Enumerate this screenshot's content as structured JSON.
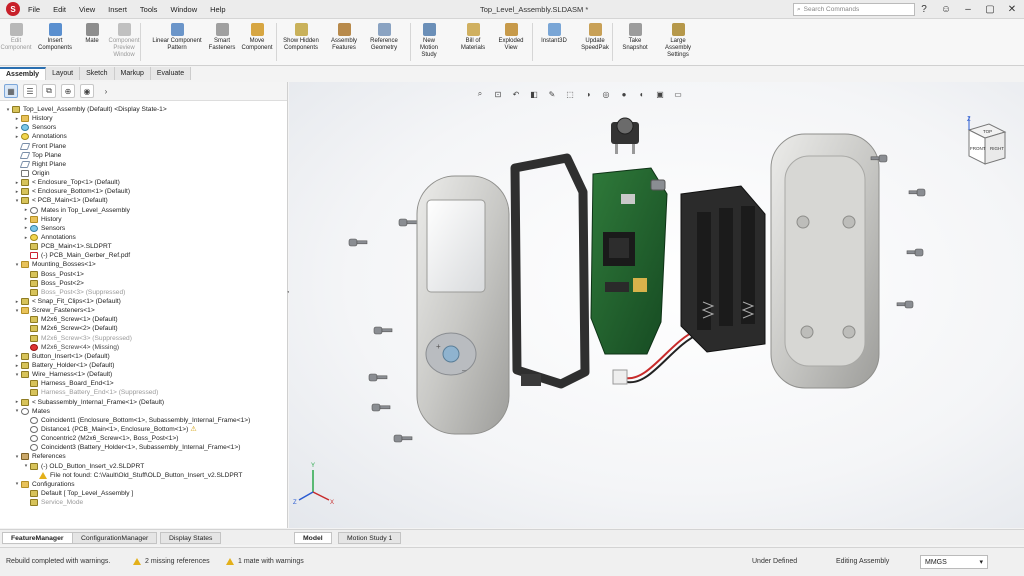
{
  "app": {
    "logo_text": "S",
    "menu": [
      "File",
      "Edit",
      "View",
      "Insert",
      "Tools",
      "Window",
      "Help"
    ],
    "doc_title": "Top_Level_Assembly.SLDASM *",
    "search_placeholder": "Search Commands",
    "title_icons": [
      "help-icon",
      "user-icon",
      "minimize-icon",
      "restore-icon",
      "close-icon"
    ]
  },
  "ribbon": {
    "buttons": [
      {
        "label": "Edit Component",
        "disabled": true,
        "icon": "edit-component-icon",
        "color": "#b8b8b8"
      },
      {
        "label": "Insert Components",
        "disabled": false,
        "icon": "insert-components-icon",
        "color": "#5a8fcf"
      },
      {
        "label": "Mate",
        "disabled": false,
        "icon": "mate-icon",
        "color": "#8d8d8d"
      },
      {
        "label": "Component Preview Window",
        "disabled": true,
        "icon": "preview-window-icon",
        "color": "#c0c0c0"
      },
      {
        "label": "Linear Component Pattern",
        "disabled": false,
        "icon": "linear-pattern-icon",
        "color": "#6b95c9"
      },
      {
        "label": "Smart Fasteners",
        "disabled": false,
        "icon": "smart-fasteners-icon",
        "color": "#a0a0a0"
      },
      {
        "label": "Move Component",
        "disabled": false,
        "icon": "move-component-icon",
        "color": "#d7a642"
      },
      {
        "label": "Show Hidden Components",
        "disabled": false,
        "icon": "show-hidden-icon",
        "color": "#c9b15a"
      },
      {
        "label": "Assembly Features",
        "disabled": false,
        "icon": "assembly-features-icon",
        "color": "#b88a4b"
      },
      {
        "label": "Reference Geometry",
        "disabled": false,
        "icon": "reference-geometry-icon",
        "color": "#8aa3c2"
      },
      {
        "label": "New Motion Study",
        "disabled": false,
        "icon": "motion-study-icon",
        "color": "#6b8fb8"
      },
      {
        "label": "Bill of Materials",
        "disabled": false,
        "icon": "bom-icon",
        "color": "#d0b060"
      },
      {
        "label": "Exploded View",
        "disabled": false,
        "icon": "exploded-view-icon",
        "color": "#c79a4a"
      },
      {
        "label": "Instant3D",
        "disabled": false,
        "icon": "instant3d-icon",
        "color": "#7aa6d6"
      },
      {
        "label": "Update SpeedPak",
        "disabled": false,
        "icon": "speedpak-icon",
        "color": "#c8a056"
      },
      {
        "label": "Take Snapshot",
        "disabled": false,
        "icon": "snapshot-icon",
        "color": "#9c9c9c"
      },
      {
        "label": "Large Assembly Settings",
        "disabled": false,
        "icon": "large-assembly-icon",
        "color": "#b6984a"
      }
    ]
  },
  "command_tabs": [
    "Assembly",
    "Layout",
    "Sketch",
    "Markup",
    "Evaluate"
  ],
  "active_command_tab": "Assembly",
  "feature_tree": {
    "toolbar_icons": [
      "feature-manager-icon",
      "property-manager-icon",
      "configuration-manager-icon",
      "dimxpert-icon",
      "display-manager-icon"
    ],
    "rows": [
      {
        "level": 0,
        "tog": "▾",
        "icon": "part",
        "text": "Top_Level_Assembly (Default) <Display State-1>"
      },
      {
        "level": 1,
        "tog": "▸",
        "icon": "folder",
        "text": "History"
      },
      {
        "level": 1,
        "tog": "▸",
        "icon": "sensor",
        "text": "Sensors"
      },
      {
        "level": 1,
        "tog": "▸",
        "icon": "ann",
        "text": "Annotations"
      },
      {
        "level": 1,
        "tog": "",
        "icon": "plane",
        "text": "Front Plane"
      },
      {
        "level": 1,
        "tog": "",
        "icon": "plane",
        "text": "Top Plane"
      },
      {
        "level": 1,
        "tog": "",
        "icon": "plane",
        "text": "Right Plane"
      },
      {
        "level": 1,
        "tog": "",
        "icon": "origin",
        "text": "Origin"
      },
      {
        "level": 1,
        "tog": "▸",
        "icon": "part",
        "text": "< Enclosure_Top<1> (Default)"
      },
      {
        "level": 1,
        "tog": "▸",
        "icon": "part",
        "text": "< Enclosure_Bottom<1> (Default)"
      },
      {
        "level": 1,
        "tog": "▾",
        "icon": "part",
        "text": "< PCB_Main<1> (Default)"
      },
      {
        "level": 2,
        "tog": "▸",
        "icon": "mate",
        "text": "Mates in Top_Level_Assembly"
      },
      {
        "level": 2,
        "tog": "▸",
        "icon": "folder",
        "text": "History"
      },
      {
        "level": 2,
        "tog": "▸",
        "icon": "sensor",
        "text": "Sensors"
      },
      {
        "level": 2,
        "tog": "▸",
        "icon": "ann",
        "text": "Annotations"
      },
      {
        "level": 2,
        "tog": "",
        "icon": "part",
        "text": "PCB_Main<1>.SLDPRT"
      },
      {
        "level": 2,
        "tog": "",
        "icon": "doc",
        "text": "(-) PCB_Main_Gerber_Ref.pdf"
      },
      {
        "level": 1,
        "tog": "▾",
        "icon": "folder",
        "text": "Mounting_Bosses<1>"
      },
      {
        "level": 2,
        "tog": "",
        "icon": "part",
        "text": "Boss_Post<1>"
      },
      {
        "level": 2,
        "tog": "",
        "icon": "part",
        "text": "Boss_Post<2>"
      },
      {
        "level": 2,
        "tog": "",
        "icon": "part",
        "text": "Boss_Post<3> (Suppressed)",
        "style": "sup"
      },
      {
        "level": 1,
        "tog": "▸",
        "icon": "part",
        "text": "< Snap_Fit_Clips<1> (Default)"
      },
      {
        "level": 1,
        "tog": "▾",
        "icon": "folder",
        "text": "Screw_Fasteners<1>"
      },
      {
        "level": 2,
        "tog": "",
        "icon": "part",
        "text": "M2x6_Screw<1> (Default)"
      },
      {
        "level": 2,
        "tog": "",
        "icon": "part",
        "text": "M2x6_Screw<2> (Default)"
      },
      {
        "level": 2,
        "tog": "",
        "icon": "part",
        "text": "M2x6_Screw<3> (Suppressed)",
        "style": "sup"
      },
      {
        "level": 2,
        "tog": "",
        "icon": "err",
        "text": "M2x6_Screw<4> (Missing)",
        "style": "miss"
      },
      {
        "level": 1,
        "tog": "▸",
        "icon": "part",
        "text": "Button_Insert<1> (Default)"
      },
      {
        "level": 1,
        "tog": "▸",
        "icon": "part",
        "text": "Battery_Holder<1> (Default)"
      },
      {
        "level": 1,
        "tog": "▾",
        "icon": "part",
        "text": "Wire_Harness<1> (Default)"
      },
      {
        "level": 2,
        "tog": "",
        "icon": "part",
        "text": "Harness_Board_End<1>"
      },
      {
        "level": 2,
        "tog": "",
        "icon": "part",
        "text": "Harness_Battery_End<1> (Suppressed)",
        "style": "sup"
      },
      {
        "level": 1,
        "tog": "▸",
        "icon": "part",
        "text": "< Subassembly_Internal_Frame<1> (Default)"
      },
      {
        "level": 1,
        "tog": "▾",
        "icon": "mate",
        "text": "Mates"
      },
      {
        "level": 2,
        "tog": "",
        "icon": "mate",
        "text": "Coincident1 (Enclosure_Bottom<1>, Subassembly_Internal_Frame<1>)"
      },
      {
        "level": 2,
        "tog": "",
        "icon": "mate",
        "text": "Distance1 (PCB_Main<1>, Enclosure_Bottom<1>)",
        "warn": "⚠"
      },
      {
        "level": 2,
        "tog": "",
        "icon": "mate",
        "text": "Concentric2 (M2x6_Screw<1>, Boss_Post<1>)"
      },
      {
        "level": 2,
        "tog": "",
        "icon": "mate",
        "text": "Coincident3 (Battery_Holder<1>, Subassembly_Internal_Frame<1>)"
      },
      {
        "level": 1,
        "tog": "▾",
        "icon": "ref",
        "text": "References"
      },
      {
        "level": 2,
        "tog": "▾",
        "icon": "part",
        "text": "(-) OLD_Button_Insert_v2.SLDPRT"
      },
      {
        "level": 3,
        "tog": "",
        "icon": "warn",
        "text": "File not found: C:\\Vault\\Old_Stuff\\OLD_Button_Insert_v2.SLDPRT"
      },
      {
        "level": 1,
        "tog": "▾",
        "icon": "folder",
        "text": "Configurations"
      },
      {
        "level": 2,
        "tog": "",
        "icon": "part",
        "text": "Default [ Top_Level_Assembly ]"
      },
      {
        "level": 2,
        "tog": "",
        "icon": "part",
        "text": "Service_Mode",
        "style": "sup"
      }
    ]
  },
  "bottom_tabs": {
    "left": [
      "FeatureManager",
      "ConfigurationManager",
      "Display States"
    ],
    "left_active": "FeatureManager",
    "right": [
      "Model",
      "Motion Study 1"
    ],
    "right_active": "Model"
  },
  "viewport": {
    "hud_icons": [
      "zoom-to-fit-icon",
      "zoom-area-icon",
      "previous-view-icon",
      "section-view-icon",
      "dynamic-annotation-icon",
      "view-orientation-icon",
      "display-style-icon",
      "hide-show-icon",
      "edit-appearance-icon",
      "apply-scene-icon",
      "view-settings-icon",
      "display-pane-icon"
    ],
    "viewcube": {
      "top": "TOP",
      "front": "FRONT",
      "right": "RIGHT",
      "axis_z": "Z"
    },
    "triad": {
      "x": "X",
      "y": "Y",
      "z": "Z"
    },
    "colors": {
      "enclosure": "#c9c9c6",
      "frame": "#3a3a3a",
      "pcb": "#1f5a2a",
      "battery": "#2b2b2b",
      "button": "#8fb3cf"
    }
  },
  "status": {
    "left": "Rebuild completed with warnings.",
    "refs": "2 missing references",
    "mates": "1 mate with warnings",
    "state": "Under Defined",
    "mode": "Editing Assembly",
    "units": "MMGS"
  }
}
